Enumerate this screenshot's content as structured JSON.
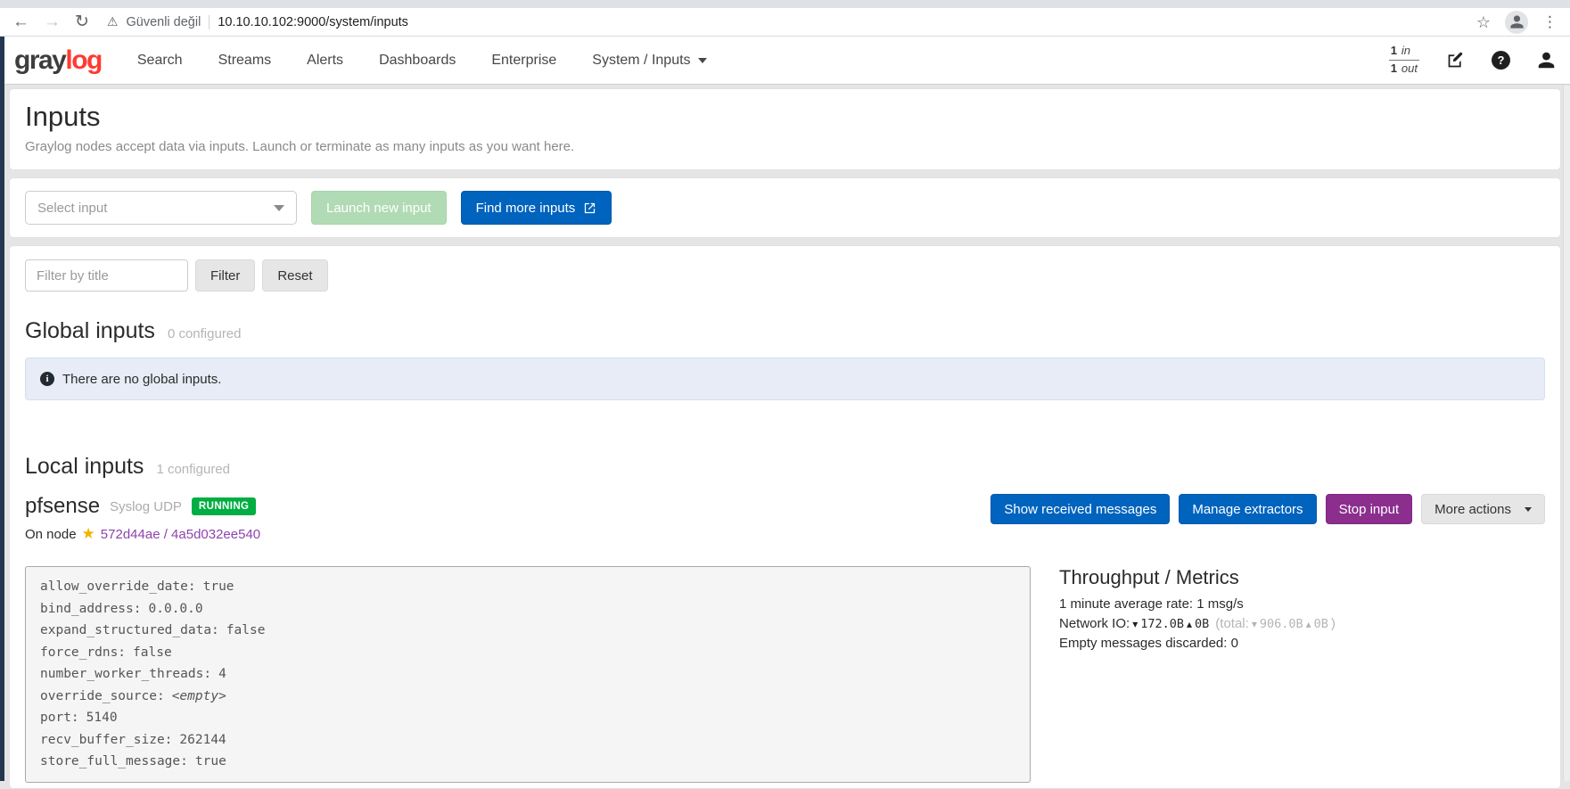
{
  "icons": {
    "back": "←",
    "forward": "→",
    "reload": "↻",
    "warning": "⚠",
    "bookmark_star": "☆",
    "menu_dots": "⋮",
    "help": "?",
    "info": "i",
    "node_star": "★",
    "down_arrow": "▾",
    "up_arrow": "▴"
  },
  "browser": {
    "security_label": "Güvenli değil",
    "url": "10.10.10.102:9000/system/inputs"
  },
  "navbar": {
    "brand_gray": "gray",
    "brand_log": "log",
    "items": [
      "Search",
      "Streams",
      "Alerts",
      "Dashboards",
      "Enterprise"
    ],
    "active_item": "System / Inputs",
    "throughput": {
      "in_value": "1",
      "in_unit": "in",
      "out_value": "1",
      "out_unit": "out"
    }
  },
  "page_header": {
    "title": "Inputs",
    "description": "Graylog nodes accept data via inputs. Launch or terminate as many inputs as you want here."
  },
  "launcher": {
    "select_placeholder": "Select input",
    "launch_label": "Launch new input",
    "find_more_label": "Find more inputs"
  },
  "filter": {
    "placeholder": "Filter by title",
    "filter_label": "Filter",
    "reset_label": "Reset"
  },
  "global_inputs": {
    "heading": "Global inputs",
    "count": "0 configured",
    "empty_message": "There are no global inputs."
  },
  "local_inputs": {
    "heading": "Local inputs",
    "count": "1 configured"
  },
  "input": {
    "name": "pfsense",
    "type": "Syslog UDP",
    "status": "RUNNING",
    "node_prefix": "On node",
    "node_link": "572d44ae / 4a5d032ee540",
    "actions": {
      "show_messages": "Show received messages",
      "manage_extractors": "Manage extractors",
      "stop": "Stop input",
      "more": "More actions"
    },
    "config": [
      {
        "k": "allow_override_date:",
        "v": "true"
      },
      {
        "k": "bind_address:",
        "v": "0.0.0.0"
      },
      {
        "k": "expand_structured_data:",
        "v": "false"
      },
      {
        "k": "force_rdns:",
        "v": "false"
      },
      {
        "k": "number_worker_threads:",
        "v": "4"
      },
      {
        "k": "override_source:",
        "v": "<empty>"
      },
      {
        "k": "port:",
        "v": "5140"
      },
      {
        "k": "recv_buffer_size:",
        "v": "262144"
      },
      {
        "k": "store_full_message:",
        "v": "true"
      }
    ],
    "metrics": {
      "heading": "Throughput / Metrics",
      "avg_rate": "1 minute average rate: 1 msg/s",
      "network_io_label": "Network IO:",
      "io_down": "172.0B",
      "io_up": "0B",
      "total_open": "(total:",
      "total_down": "906.0B",
      "total_up": "0B",
      "total_close": ")",
      "empty_discarded": "Empty messages discarded: 0"
    }
  },
  "colors": {
    "primary_blue": "#0063be",
    "running_green": "#00ae42",
    "stop_purple": "#8b2e8e",
    "link_purple": "#8e44ad",
    "brand_red": "#ff3b30",
    "disabled_green": "#b1dbb4"
  }
}
